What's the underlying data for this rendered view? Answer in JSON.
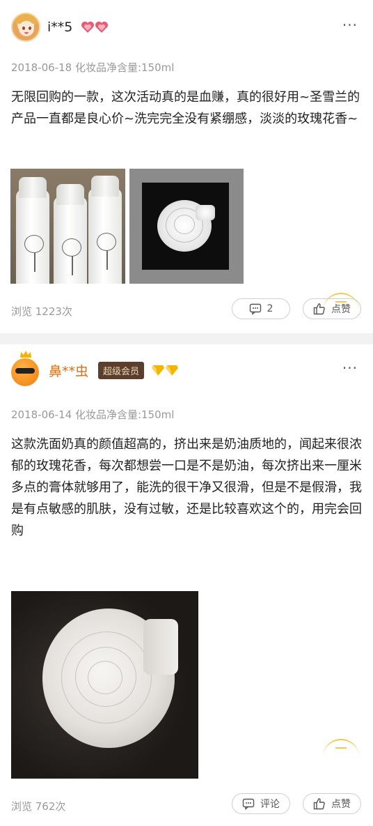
{
  "reviews": [
    {
      "username": "i**5",
      "meta": "2018-06-18 化妆品净含量:150ml",
      "text": "无限回购的一款，这次活动真的是血赚，真的很好用~圣雪兰的产品一直都是良心价~洗完完全没有紧绷感，淡淡的玫瑰花香~",
      "views": "浏览 1223次",
      "comment_label": "2",
      "like_label": "点赞",
      "more_label": "···"
    },
    {
      "username": "鼻**虫",
      "badge": "超级会员",
      "meta": "2018-06-14 化妆品净含量:150ml",
      "text": "这款洗面奶真的颜值超高的，挤出来是奶油质地的，闻起来很浓郁的玫瑰花香，每次都想尝一口是不是奶油，每次挤出来一厘米多点的膏体就够用了，能洗的很干净又很滑，但是不是假滑，我是有点敏感的肌肤，没有过敏，还是比较喜欢这个的，用完会回购",
      "views": "浏览 762次",
      "comment_label": "评论",
      "like_label": "点赞",
      "more_label": "···"
    }
  ],
  "icons": {
    "member_hearts": "heart-badge-icon",
    "vip_diamonds": "diamond-badge-icon",
    "comment": "comment-icon",
    "like": "thumbs-up-icon"
  },
  "colors": {
    "username_vip": "#e06c0a",
    "badge_bg": "#5a3f2e",
    "badge_text": "#f3d8b0",
    "accent": "#f2c94c"
  }
}
